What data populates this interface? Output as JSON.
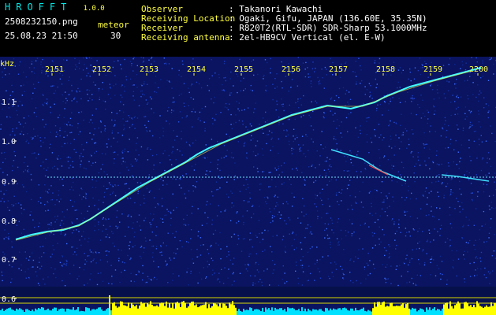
{
  "header": {
    "brand": "HROFFT",
    "version": "1.0.0",
    "filename": "2508232150.png",
    "datetime": "25.08.23 21:50",
    "mode_label": "meteor",
    "mode_value": "30",
    "fields": [
      {
        "label": "Observer",
        "value": ": Takanori Kawachi"
      },
      {
        "label": "Receiving Location",
        "value": ": Ogaki, Gifu, JAPAN (136.60E, 35.35N)"
      },
      {
        "label": "Receiver",
        "value": ": R820T2(RTL-SDR) SDR-Sharp 53.1000MHz"
      },
      {
        "label": "Receiving antenna",
        "value": ": 2el-HB9CV Vertical (el. E-W)"
      }
    ]
  },
  "spectrogram": {
    "unit_label": "kHz",
    "time_ticks": [
      "2151",
      "2152",
      "2153",
      "2154",
      "2155",
      "2156",
      "2157",
      "2158",
      "2159",
      "2200"
    ],
    "freq_ticks": [
      "1.1",
      "1.0",
      "0.9",
      "0.8",
      "0.7",
      "0.6"
    ],
    "colors": {
      "background": "#0a1460",
      "grid": "#d8d800",
      "trace_cyan": "#40ffff",
      "trace_yellow": "#ffff40",
      "trace_red": "#ff4040",
      "level": "#00e0ff",
      "level_peak": "#ffff00"
    }
  }
}
